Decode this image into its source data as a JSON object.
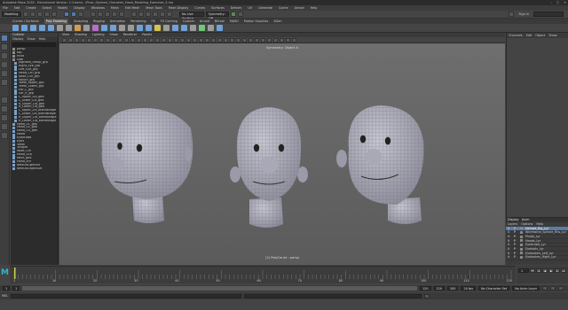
{
  "window": {
    "title": "Autodesk Maya 2018 - Educational Version: C:\\Users\\...\\Pixar_Stylized_Character_Head_Modeling_Exercises_3.ma",
    "controls": [
      "–",
      "□",
      "✕"
    ]
  },
  "menubar": [
    "File",
    "Edit",
    "Create",
    "Select",
    "Modify",
    "Display",
    "Windows",
    "Mesh",
    "Edit Mesh",
    "Mesh Tools",
    "Mesh Display",
    "Curves",
    "Surfaces",
    "Deform",
    "UV",
    "Generate",
    "Cache",
    "Arnold",
    "Help"
  ],
  "statusline": {
    "mode": "Modeling",
    "live": "No Live Surface",
    "symmetry": "Symmetry: Off",
    "account": "Sign In"
  },
  "shelf": {
    "tabs": [
      "Curves / Surfaces",
      "Poly Modeling",
      "Sculpting",
      "Rigging",
      "Animation",
      "Rendering",
      "FX",
      "FX Caching",
      "Custom",
      "Arnold",
      "Bifrost",
      "MASH",
      "Motion Graphics",
      "XGen"
    ],
    "active_tab": "Poly Modeling",
    "icon_colors": [
      "#6fa2d8",
      "#6fa2d8",
      "#6fa2d8",
      "#6fa2d8",
      "#6fa2d8",
      "#9b9b9b",
      "#9b9b9b",
      "#d49b4e",
      "#9b9b9b",
      "#b66fc8",
      "#6fa2d8",
      "#6fa2d8",
      "#9b9b9b",
      "#9b9b9b",
      "#6fa2d8",
      "#6fa2d8",
      "#d4c34e",
      "#9b9b9b",
      "#6fa2d8",
      "#6fa2d8",
      "#9b9b9b",
      "#6fc878",
      "#9b9b9b",
      "#6fa2d8"
    ]
  },
  "outliner": {
    "title": "Outliner",
    "menu": [
      "Display",
      "Show",
      "Help"
    ],
    "items": [
      "persp",
      "top",
      "front",
      "side",
      "Jughead_Setup_grp",
      "Right_Eye_grp",
      "Left_Eye_grp",
      "Head_Ctrl_grp",
      "Nose_Ctrl_grp",
      "Mouth_grp",
      "Teeth_Upper_grp",
      "Teeth_Lower_grp",
      "Ear_L_grp",
      "Ear_R_grp",
      "L_Upper_Lid_geo",
      "L_Lower_Lid_geo",
      "R_Upper_Lid_geo",
      "R_Lower_Lid_geo",
      "L_Upper_Lid_blendshape",
      "L_Lower_Lid_blendshape",
      "R_Upper_Lid_blendshape",
      "R_Lower_Lid_blendshape",
      "Head_01_geo",
      "Head_02_geo",
      "Head_03_geo",
      "Head",
      "Eyebrows",
      "Eyes",
      "Teeth",
      "Tongue",
      "Nose_Ctrl",
      "Head_Grp",
      "Neck_geo",
      "Head_ctrl",
      "defaultLightSet",
      "defaultObjectSet"
    ]
  },
  "viewport": {
    "menu": [
      "View",
      "Shading",
      "Lighting",
      "Show",
      "Renderer",
      "Panels"
    ],
    "label": "Symmetry: Object X",
    "camera_label": "(2) PolyCount : persp"
  },
  "right_panel": {
    "tabs": [
      "Channels",
      "Edit",
      "Object",
      "Show"
    ]
  },
  "layers": {
    "tabs": [
      "Display",
      "Anim"
    ],
    "menu": [
      "Layers",
      "Options",
      "Help"
    ],
    "rows": [
      "Helmet_Rig_Lyr",
      "Wireframe_Sphere_Rhs_Lyr",
      "Pivots_Lyr",
      "Heads_Lyr",
      "Eyebrows_Lyr",
      "Eyeballs_Lyr",
      "Eyelashes_Left_Lyr",
      "Eyelashes_Right_Lyr"
    ],
    "visibility": "V",
    "playback": "P"
  },
  "timeline": {
    "ticks": [
      "1",
      "10",
      "20",
      "30",
      "40",
      "50",
      "60",
      "70",
      "80",
      "90",
      "100",
      "110",
      "120"
    ],
    "current_frame": "1"
  },
  "range": {
    "start": "1",
    "inner_start": "1",
    "inner_end": "120",
    "end": "120",
    "end2": "200",
    "char_set": "No Character Set",
    "anim_layer": "No Anim Layer",
    "fps": "24 fps"
  },
  "command": {
    "lang": "MEL"
  },
  "logo": "M"
}
